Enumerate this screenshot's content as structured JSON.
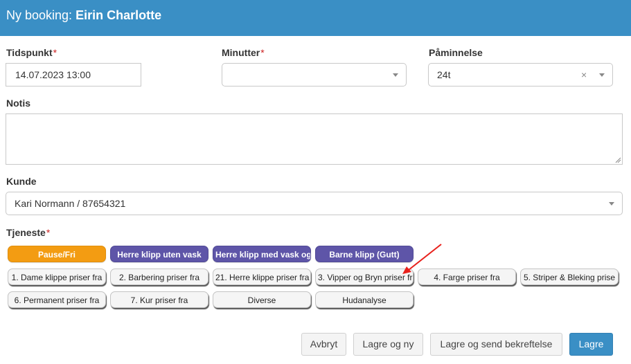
{
  "header": {
    "prefix": "Ny booking: ",
    "customer_name": "Eirin Charlotte"
  },
  "form": {
    "time": {
      "label": "Tidspunkt",
      "required": "*",
      "value": "14.07.2023 13:00"
    },
    "minutes": {
      "label": "Minutter",
      "required": "*",
      "value": ""
    },
    "reminder": {
      "label": "Påminnelse",
      "value": "24t",
      "clear": "×"
    },
    "note": {
      "label": "Notis",
      "value": ""
    },
    "customer": {
      "label": "Kunde",
      "value": "Kari Normann / 87654321"
    },
    "service": {
      "label": "Tjeneste",
      "required": "*"
    }
  },
  "services": [
    {
      "label": "Pause/Fri",
      "style": "orange"
    },
    {
      "label": "Herre klipp uten vask",
      "style": "purple"
    },
    {
      "label": "Herre klipp med vask og",
      "style": "purple"
    },
    {
      "label": "Barne klipp (Gutt)",
      "style": "purple"
    },
    {
      "label": "1. Dame klippe priser fra",
      "style": "grey"
    },
    {
      "label": "2. Barbering priser fra",
      "style": "grey"
    },
    {
      "label": "21. Herre klippe priser fra",
      "style": "grey"
    },
    {
      "label": "3. Vipper og Bryn priser fra",
      "style": "grey"
    },
    {
      "label": "4. Farge priser fra",
      "style": "grey"
    },
    {
      "label": "5. Striper & Bleking prise",
      "style": "grey"
    },
    {
      "label": "6. Permanent priser fra",
      "style": "grey"
    },
    {
      "label": "7. Kur priser fra",
      "style": "grey"
    },
    {
      "label": "Diverse",
      "style": "grey"
    },
    {
      "label": "Hudanalyse",
      "style": "grey"
    }
  ],
  "buttons": {
    "cancel": "Avbryt",
    "save_new": "Lagre og ny",
    "save_send": "Lagre og send bekreftelse",
    "save": "Lagre"
  },
  "colors": {
    "header": "#3a8fc5",
    "orange_chip": "#f39c12",
    "purple_chip": "#5e55a8",
    "primary_button": "#3a8fc5",
    "annotation_arrow": "#e8211c"
  }
}
